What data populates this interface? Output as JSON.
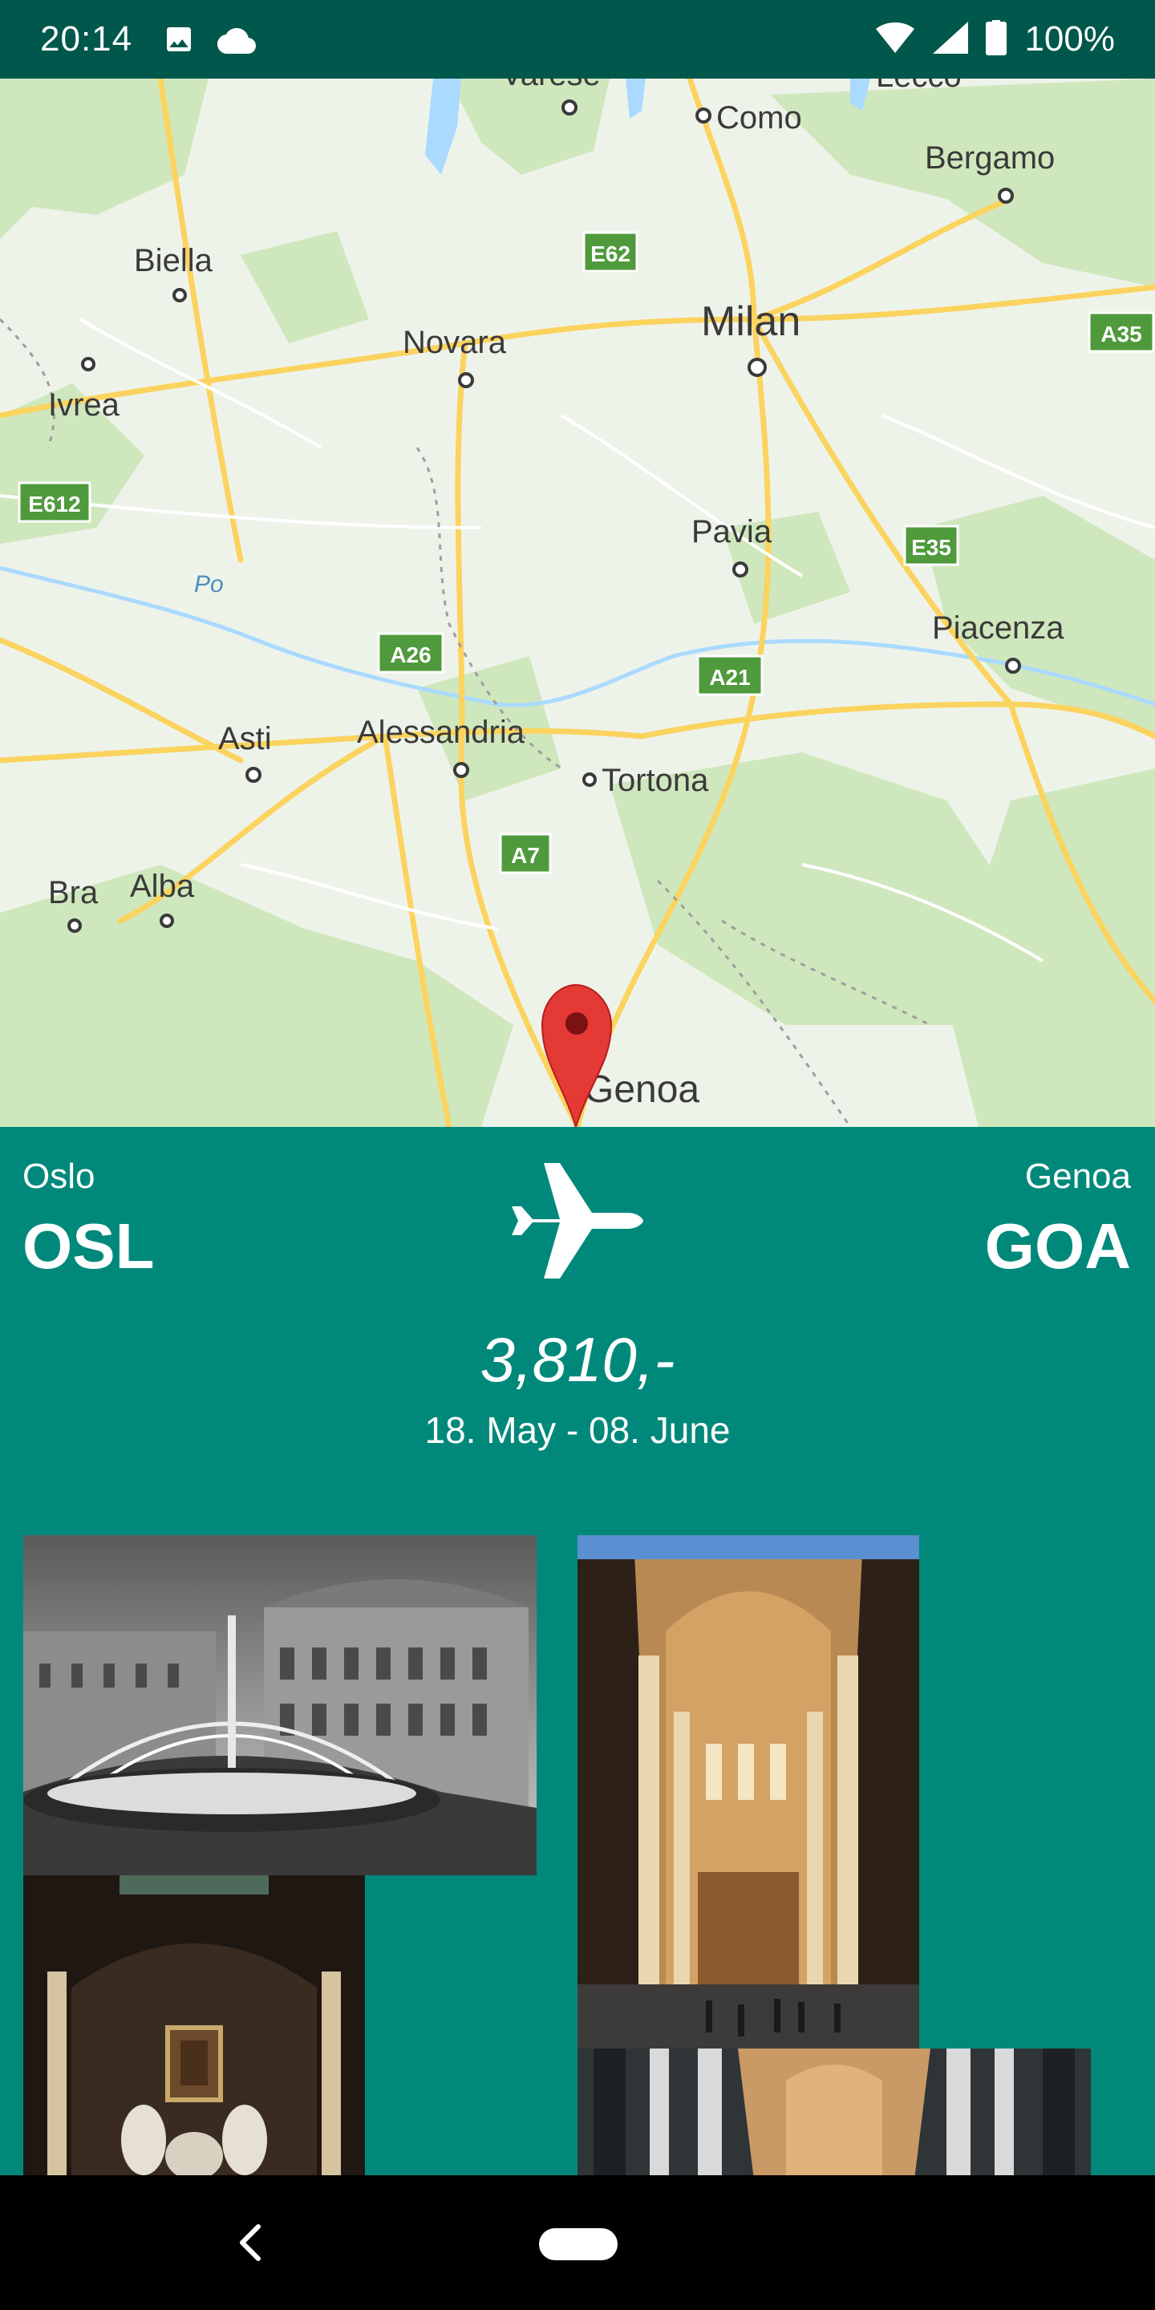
{
  "status_bar": {
    "time": "20:14",
    "battery": "100%",
    "icons": [
      "image-icon",
      "cloud-icon",
      "wifi-icon",
      "signal-icon",
      "battery-icon"
    ]
  },
  "map": {
    "cities": [
      "Varese",
      "Como",
      "Lecco",
      "Bergamo",
      "Biella",
      "Novara",
      "Milan",
      "Ivrea",
      "Pavia",
      "Piacenza",
      "Asti",
      "Alessandria",
      "Tortona",
      "Bra",
      "Alba",
      "Genoa"
    ],
    "river": "Po",
    "road_shields": [
      "E62",
      "A35",
      "E612",
      "E35",
      "A26",
      "A21",
      "A7"
    ],
    "marker": "map-pin-icon"
  },
  "flight": {
    "origin_city": "Oslo",
    "origin_code": "OSL",
    "destination_city": "Genoa",
    "destination_code": "GOA",
    "price": "3,810,-",
    "dates": "18. May - 08. June",
    "icon": "airplane-icon"
  },
  "photos": [
    "Fountain square",
    "Cathedral nave",
    "Chapel altar",
    "Church interior"
  ],
  "colors": {
    "status_bar": "#00574b",
    "panel": "#00897b",
    "marker": "#e53935"
  },
  "navigation": {
    "back_icon": "back-icon",
    "home_icon": "home-pill-icon"
  }
}
